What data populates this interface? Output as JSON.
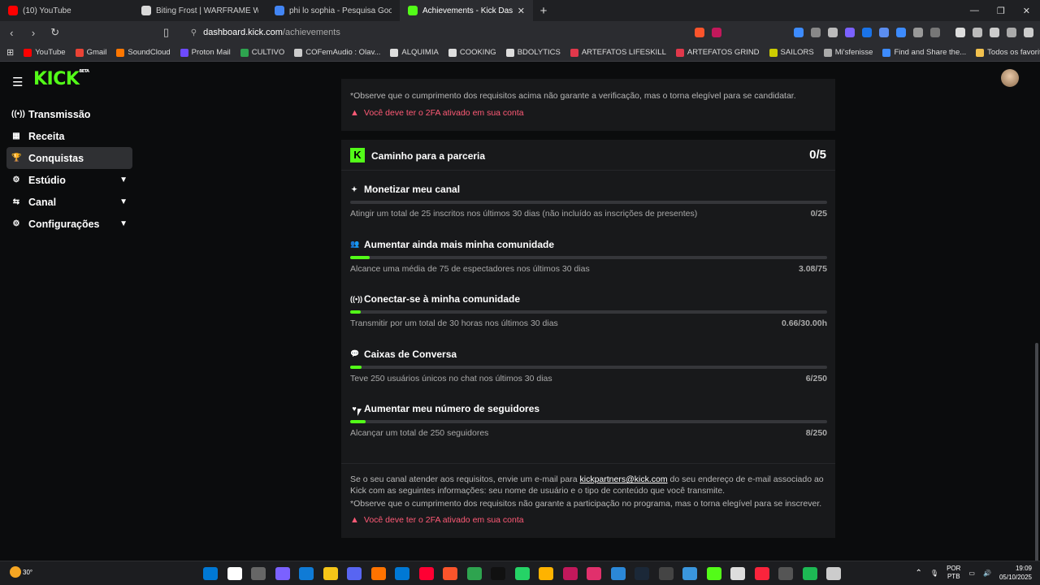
{
  "browser": {
    "tabs": [
      {
        "title": "(10) YouTube",
        "color": "#ff0000"
      },
      {
        "title": "Biting Frost | WARFRAME Wiki | Fand",
        "color": "#d9d9d9"
      },
      {
        "title": "phi lo sophia - Pesquisa Google",
        "color": "#4285f4"
      },
      {
        "title": "Achievements - Kick Dashbo",
        "color": "#53fc18"
      }
    ],
    "new_tab": "+",
    "close_tab": "✕",
    "url_host": "dashboard.kick.com",
    "url_path": "/achievements",
    "bookmarks": [
      {
        "label": "YouTube",
        "color": "#ff0000"
      },
      {
        "label": "Gmail",
        "color": "#ea4335"
      },
      {
        "label": "SoundCloud",
        "color": "#ff7700"
      },
      {
        "label": "Proton Mail",
        "color": "#6d4aff"
      },
      {
        "label": "CULTIVO",
        "color": "#2ea44f"
      },
      {
        "label": "COFemAudio : Olav...",
        "color": "#cccccc"
      },
      {
        "label": "ALQUIMIA",
        "color": "#dddddd"
      },
      {
        "label": "COOKING",
        "color": "#dddddd"
      },
      {
        "label": "BDOLYTICS",
        "color": "#dddddd"
      },
      {
        "label": "ARTEFATOS LIFESKILL",
        "color": "#e0384b"
      },
      {
        "label": "ARTEFATOS GRIND",
        "color": "#e0384b"
      },
      {
        "label": "SAILORS",
        "color": "#cccc00"
      },
      {
        "label": "Mi'sfenisse",
        "color": "#aaaaaa"
      },
      {
        "label": "Find and Share the...",
        "color": "#3d8bfd"
      }
    ],
    "favorites_label": "Todos os favoritos"
  },
  "sidebar": {
    "items": [
      {
        "label": "Transmissão",
        "icon": "broadcast-icon",
        "glyph": "((•))",
        "active": false,
        "expandable": false
      },
      {
        "label": "Receita",
        "icon": "wallet-icon",
        "glyph": "▦",
        "active": false,
        "expandable": false
      },
      {
        "label": "Conquistas",
        "icon": "trophy-icon",
        "glyph": "🏆",
        "active": true,
        "expandable": false
      },
      {
        "label": "Estúdio",
        "icon": "studio-icon",
        "glyph": "⚙",
        "active": false,
        "expandable": true
      },
      {
        "label": "Canal",
        "icon": "channel-icon",
        "glyph": "⇆",
        "active": false,
        "expandable": true
      },
      {
        "label": "Configurações",
        "icon": "settings-icon",
        "glyph": "⚙",
        "active": false,
        "expandable": true
      }
    ]
  },
  "top_card": {
    "note": "*Observe que o cumprimento dos requisitos acima não garante a verificação, mas o torna elegível para se candidatar.",
    "warning": "Você deve ter o 2FA ativado em sua conta"
  },
  "partner_card": {
    "title": "Caminho para a parceria",
    "count": "0/5",
    "goals": [
      {
        "title": "Monetizar meu canal",
        "icon": "sparkle-icon",
        "glyph": "✦",
        "desc": "Atingir um total de 25 inscritos nos últimos 30 dias (não incluído as inscrições de presentes)",
        "value": "0/25",
        "progress": 0.0
      },
      {
        "title": "Aumentar ainda mais minha comunidade",
        "icon": "community-icon",
        "glyph": "👥",
        "desc": "Alcance uma média de 75 de espectadores nos últimos 30 dias",
        "value": "3.08/75",
        "progress": 0.041
      },
      {
        "title": "Conectar-se à minha comunidade",
        "icon": "broadcast-icon",
        "glyph": "((•))",
        "desc": "Transmitir por um total de 30 horas nos últimos 30 dias",
        "value": "0.66/30.00h",
        "progress": 0.022
      },
      {
        "title": "Caixas de Conversa",
        "icon": "chat-icon",
        "glyph": "💬",
        "desc": "Teve 250 usuários únicos no chat nos últimos 30 dias",
        "value": "6/250",
        "progress": 0.024
      },
      {
        "title": "Aumentar meu número de seguidores",
        "icon": "heart-icon",
        "glyph": "♥",
        "desc": "Alcançar um total de 250 seguidores",
        "value": "8/250",
        "progress": 0.032
      }
    ]
  },
  "footer": {
    "text_before": "Se o seu canal atender aos requisitos, envie um e-mail para ",
    "email": "kickpartners@kick.com",
    "text_after": " do seu endereço de e-mail associado ao Kick com as seguintes informações: seu nome de usuário e o tipo de conteúdo que você transmite.",
    "note": "*Observe que o cumprimento dos requisitos não garante a participação no programa, mas o torna elegível para se inscrever.",
    "warning": "Você deve ter o 2FA ativado em sua conta"
  },
  "taskbar": {
    "temperature": "30°",
    "lang_1": "POR",
    "lang_2": "PTB",
    "time": "19:09",
    "date": "05/10/2025",
    "app_colors": [
      "#0078d4",
      "#ffffff",
      "#666666",
      "#7b61ff",
      "#0f7bd6",
      "#f5c518",
      "#5865f2",
      "#ff7300",
      "#0078d4",
      "#ff0033",
      "#fb542b",
      "#2ea44f",
      "#111111",
      "#25d366",
      "#ffb300",
      "#c2185b",
      "#e1306c",
      "#2b88d8",
      "#1b2838",
      "#444444",
      "#3a96dd",
      "#53fc18",
      "#dddddd",
      "#fa243c",
      "#555555",
      "#1db954",
      "#cccccc"
    ]
  }
}
